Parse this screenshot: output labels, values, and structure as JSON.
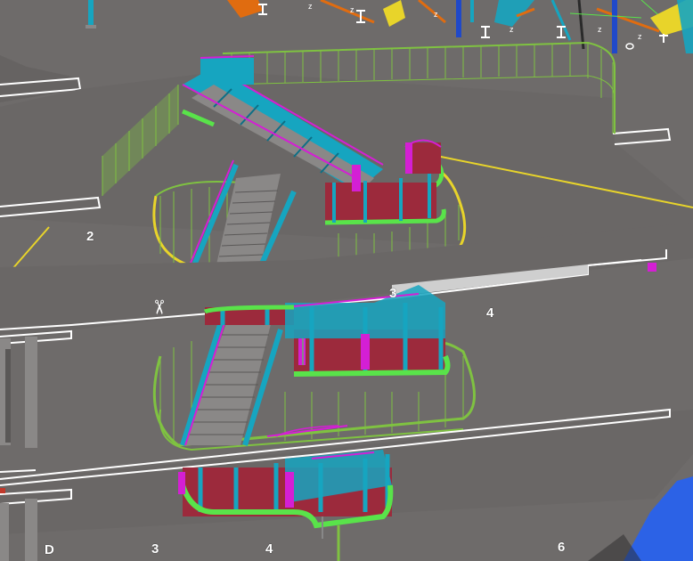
{
  "view": {
    "grid_labels": {
      "g2": "2",
      "g3_mid": "3",
      "g4_mid": "4",
      "gD": "D",
      "g3_bot": "3",
      "g4_bot": "4",
      "g6_bot": "6"
    },
    "icons": {
      "cut_plane": "scissors-icon"
    },
    "colors": {
      "slab": "#6e6b6a",
      "slab_edge": "#ffffff",
      "railing": "#7fc241",
      "steel_beam": "#16a5c0",
      "steel_dark": "#0d6f86",
      "cladding": "#9c2a3c",
      "highlight": "#d41fd4",
      "kerb": "#59e34a",
      "edge_line": "#e8d42a",
      "water": "#2c62e6",
      "orange_member": "#e06c10",
      "blue_member": "#2049c9"
    }
  }
}
